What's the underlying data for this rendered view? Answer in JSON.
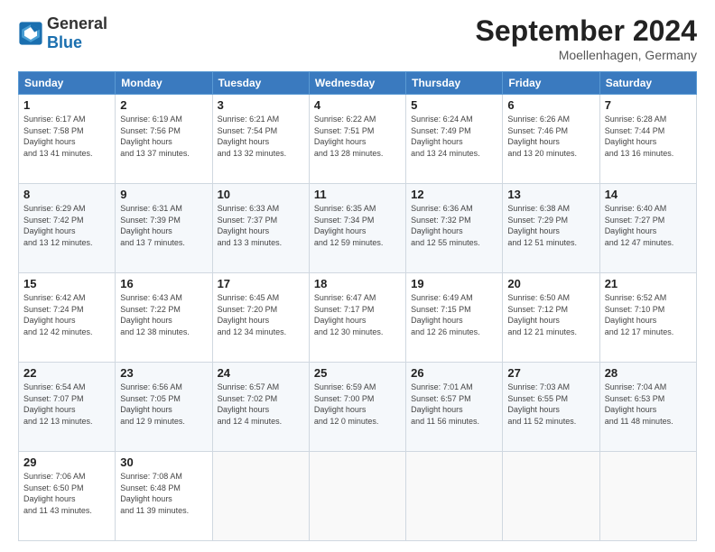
{
  "logo": {
    "general": "General",
    "blue": "Blue"
  },
  "title": "September 2024",
  "location": "Moellenhagen, Germany",
  "headers": [
    "Sunday",
    "Monday",
    "Tuesday",
    "Wednesday",
    "Thursday",
    "Friday",
    "Saturday"
  ],
  "weeks": [
    [
      {
        "day": "1",
        "sunrise": "6:17 AM",
        "sunset": "7:58 PM",
        "daylight": "13 hours and 41 minutes."
      },
      {
        "day": "2",
        "sunrise": "6:19 AM",
        "sunset": "7:56 PM",
        "daylight": "13 hours and 37 minutes."
      },
      {
        "day": "3",
        "sunrise": "6:21 AM",
        "sunset": "7:54 PM",
        "daylight": "13 hours and 32 minutes."
      },
      {
        "day": "4",
        "sunrise": "6:22 AM",
        "sunset": "7:51 PM",
        "daylight": "13 hours and 28 minutes."
      },
      {
        "day": "5",
        "sunrise": "6:24 AM",
        "sunset": "7:49 PM",
        "daylight": "13 hours and 24 minutes."
      },
      {
        "day": "6",
        "sunrise": "6:26 AM",
        "sunset": "7:46 PM",
        "daylight": "13 hours and 20 minutes."
      },
      {
        "day": "7",
        "sunrise": "6:28 AM",
        "sunset": "7:44 PM",
        "daylight": "13 hours and 16 minutes."
      }
    ],
    [
      {
        "day": "8",
        "sunrise": "6:29 AM",
        "sunset": "7:42 PM",
        "daylight": "13 hours and 12 minutes."
      },
      {
        "day": "9",
        "sunrise": "6:31 AM",
        "sunset": "7:39 PM",
        "daylight": "13 hours and 7 minutes."
      },
      {
        "day": "10",
        "sunrise": "6:33 AM",
        "sunset": "7:37 PM",
        "daylight": "13 hours and 3 minutes."
      },
      {
        "day": "11",
        "sunrise": "6:35 AM",
        "sunset": "7:34 PM",
        "daylight": "12 hours and 59 minutes."
      },
      {
        "day": "12",
        "sunrise": "6:36 AM",
        "sunset": "7:32 PM",
        "daylight": "12 hours and 55 minutes."
      },
      {
        "day": "13",
        "sunrise": "6:38 AM",
        "sunset": "7:29 PM",
        "daylight": "12 hours and 51 minutes."
      },
      {
        "day": "14",
        "sunrise": "6:40 AM",
        "sunset": "7:27 PM",
        "daylight": "12 hours and 47 minutes."
      }
    ],
    [
      {
        "day": "15",
        "sunrise": "6:42 AM",
        "sunset": "7:24 PM",
        "daylight": "12 hours and 42 minutes."
      },
      {
        "day": "16",
        "sunrise": "6:43 AM",
        "sunset": "7:22 PM",
        "daylight": "12 hours and 38 minutes."
      },
      {
        "day": "17",
        "sunrise": "6:45 AM",
        "sunset": "7:20 PM",
        "daylight": "12 hours and 34 minutes."
      },
      {
        "day": "18",
        "sunrise": "6:47 AM",
        "sunset": "7:17 PM",
        "daylight": "12 hours and 30 minutes."
      },
      {
        "day": "19",
        "sunrise": "6:49 AM",
        "sunset": "7:15 PM",
        "daylight": "12 hours and 26 minutes."
      },
      {
        "day": "20",
        "sunrise": "6:50 AM",
        "sunset": "7:12 PM",
        "daylight": "12 hours and 21 minutes."
      },
      {
        "day": "21",
        "sunrise": "6:52 AM",
        "sunset": "7:10 PM",
        "daylight": "12 hours and 17 minutes."
      }
    ],
    [
      {
        "day": "22",
        "sunrise": "6:54 AM",
        "sunset": "7:07 PM",
        "daylight": "12 hours and 13 minutes."
      },
      {
        "day": "23",
        "sunrise": "6:56 AM",
        "sunset": "7:05 PM",
        "daylight": "12 hours and 9 minutes."
      },
      {
        "day": "24",
        "sunrise": "6:57 AM",
        "sunset": "7:02 PM",
        "daylight": "12 hours and 4 minutes."
      },
      {
        "day": "25",
        "sunrise": "6:59 AM",
        "sunset": "7:00 PM",
        "daylight": "12 hours and 0 minutes."
      },
      {
        "day": "26",
        "sunrise": "7:01 AM",
        "sunset": "6:57 PM",
        "daylight": "11 hours and 56 minutes."
      },
      {
        "day": "27",
        "sunrise": "7:03 AM",
        "sunset": "6:55 PM",
        "daylight": "11 hours and 52 minutes."
      },
      {
        "day": "28",
        "sunrise": "7:04 AM",
        "sunset": "6:53 PM",
        "daylight": "11 hours and 48 minutes."
      }
    ],
    [
      {
        "day": "29",
        "sunrise": "7:06 AM",
        "sunset": "6:50 PM",
        "daylight": "11 hours and 43 minutes."
      },
      {
        "day": "30",
        "sunrise": "7:08 AM",
        "sunset": "6:48 PM",
        "daylight": "11 hours and 39 minutes."
      },
      null,
      null,
      null,
      null,
      null
    ]
  ]
}
